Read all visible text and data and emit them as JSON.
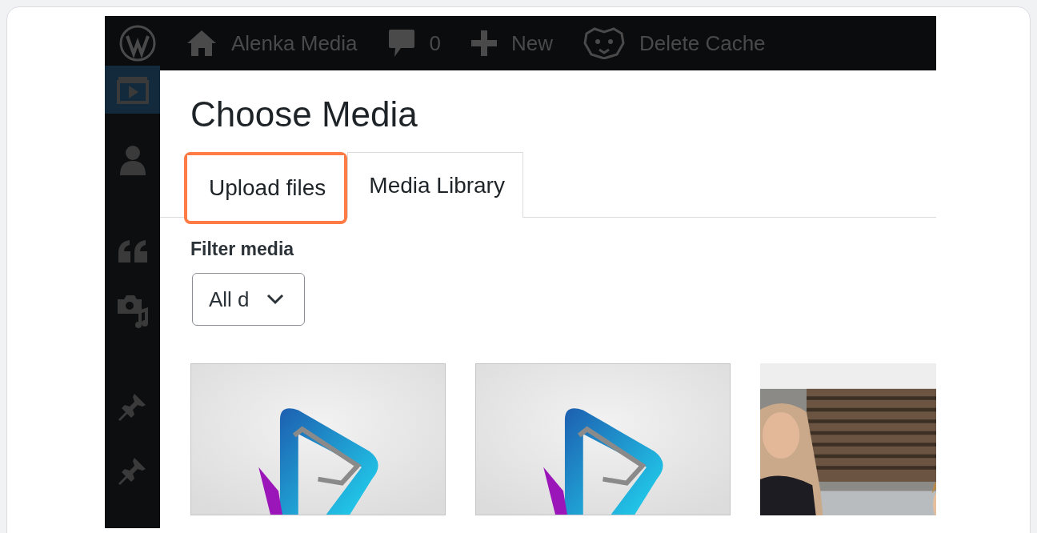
{
  "admin_bar": {
    "items": [
      {
        "kind": "wp-logo"
      },
      {
        "kind": "home",
        "label": "Alenka Media"
      },
      {
        "kind": "comments",
        "label": "0"
      },
      {
        "kind": "new",
        "label": "New"
      },
      {
        "kind": "cache",
        "label": "Delete Cache"
      }
    ]
  },
  "sidebar": {
    "items": [
      {
        "kind": "media",
        "selected": true
      },
      {
        "kind": "user",
        "selected": false
      },
      {
        "kind": "quote",
        "selected": false
      },
      {
        "kind": "camera-music",
        "selected": false
      },
      {
        "kind": "pin",
        "selected": false
      },
      {
        "kind": "pin",
        "selected": false
      }
    ]
  },
  "dialog": {
    "title": "Choose Media",
    "tabs": [
      {
        "label": "Upload files",
        "selected": false,
        "highlighted": true
      },
      {
        "label": "Media Library",
        "selected": true,
        "highlighted": false
      }
    ],
    "filter": {
      "label": "Filter media",
      "select_value": "All d"
    },
    "thumbnails": [
      {
        "kind": "logo"
      },
      {
        "kind": "logo"
      },
      {
        "kind": "picture"
      }
    ]
  }
}
